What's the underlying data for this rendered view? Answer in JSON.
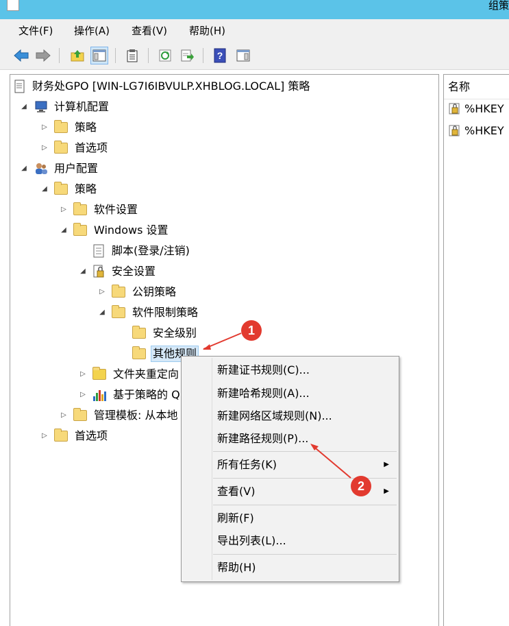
{
  "window": {
    "title": "组策"
  },
  "menubar": [
    "文件(F)",
    "操作(A)",
    "查看(V)",
    "帮助(H)"
  ],
  "toolbar": {
    "buttons": [
      "back-icon",
      "forward-icon",
      "up-folder-icon",
      "show-hide-tree-icon",
      "properties-icon",
      "refresh-icon",
      "export-list-icon",
      "help-icon",
      "action-pane-icon"
    ]
  },
  "tree": {
    "root": "财务处GPO [WIN-LG7I6IBVULP.XHBLOG.LOCAL] 策略",
    "computer_config": "计算机配置",
    "cc_policies": "策略",
    "cc_preferences": "首选项",
    "user_config": "用户配置",
    "uc_policies": "策略",
    "software_settings": "软件设置",
    "windows_settings": "Windows 设置",
    "scripts": "脚本(登录/注销)",
    "security_settings": "安全设置",
    "public_key": "公钥策略",
    "srp": "软件限制策略",
    "security_levels": "安全级别",
    "additional_rules": "其他规则",
    "folder_redirection": "文件夹重定向",
    "policy_based_qos": "基于策略的 Q",
    "admin_templates": "管理模板: 从本地",
    "uc_preferences": "首选项"
  },
  "list": {
    "header": "名称",
    "rows": [
      "%HKEY",
      "%HKEY"
    ]
  },
  "context_menu": {
    "items": [
      "新建证书规则(C)...",
      "新建哈希规则(A)...",
      "新建网络区域规则(N)...",
      "新建路径规则(P)...",
      "所有任务(K)",
      "查看(V)",
      "刷新(F)",
      "导出列表(L)...",
      "帮助(H)"
    ]
  },
  "annotations": {
    "badge1": "1",
    "badge2": "2",
    "color": "#e23a2f"
  },
  "truncated_fragment": "."
}
